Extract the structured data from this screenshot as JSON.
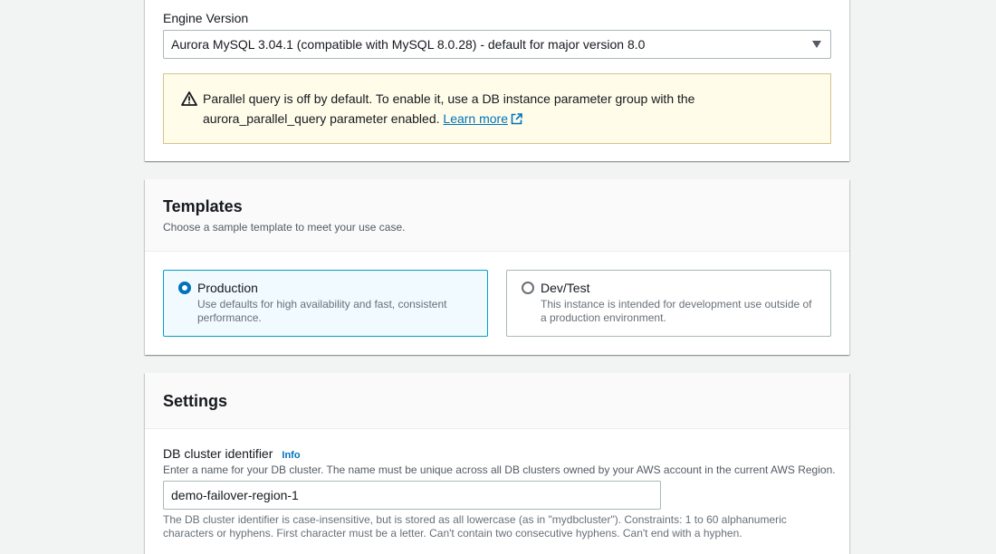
{
  "engine": {
    "label": "Engine Version",
    "selected_value": "Aurora MySQL 3.04.1 (compatible with MySQL 8.0.28) - default for major version 8.0",
    "alert": {
      "line1": "Parallel query is off by default. To enable it, use a DB instance parameter group with the",
      "line2": "aurora_parallel_query parameter enabled.",
      "link_text": "Learn more"
    }
  },
  "templates": {
    "title": "Templates",
    "description": "Choose a sample template to meet your use case.",
    "options": [
      {
        "label": "Production",
        "description": "Use defaults for high availability and fast, consistent performance.",
        "selected": true
      },
      {
        "label": "Dev/Test",
        "description": "This instance is intended for development use outside of a production environment.",
        "selected": false
      }
    ]
  },
  "settings": {
    "title": "Settings",
    "cluster_identifier": {
      "label": "DB cluster identifier",
      "info_link": "Info",
      "description": "Enter a name for your DB cluster. The name must be unique across all DB clusters owned by your AWS account in the current AWS Region.",
      "value": "demo-failover-region-1",
      "constraint": "The DB cluster identifier is case-insensitive, but is stored as all lowercase (as in \"mydbcluster\"). Constraints: 1 to 60 alphanumeric characters or hyphens. First character must be a letter. Can't contain two consecutive hyphens. Can't end with a hyphen."
    }
  },
  "colors": {
    "link": "#0073bb",
    "selected_tile_border": "#00a1c9",
    "alert_background": "#fffce9"
  },
  "icons": [
    "warning-icon",
    "external-link-icon",
    "chevron-down-icon"
  ]
}
